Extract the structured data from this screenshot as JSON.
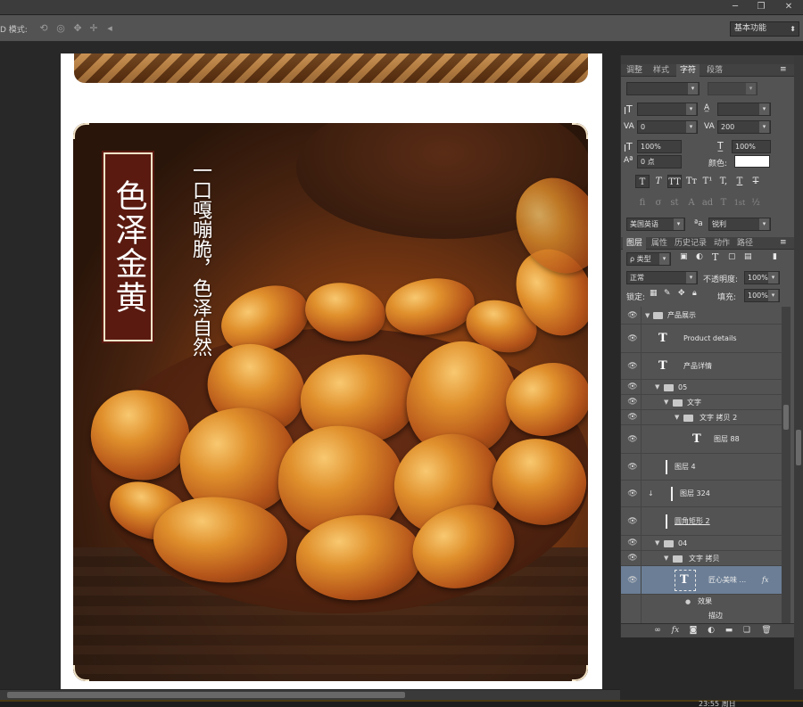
{
  "window": {
    "minimize": "─",
    "restore": "❐",
    "close": "✕"
  },
  "options_bar": {
    "mode_label": "D 模式:",
    "tools": [
      "rotate-3d-icon",
      "roll-3d-icon",
      "pan-3d-icon",
      "slide-3d-icon",
      "camera-3d-icon"
    ],
    "workspace": "基本功能"
  },
  "document": {
    "label_title": "色泽金黄",
    "tagline": "一口嘎嘣脆，色泽自然"
  },
  "char_panel": {
    "tabs": [
      "调整",
      "样式",
      "字符",
      "段落"
    ],
    "active_tab": "字符",
    "leading_value": "",
    "kerning_value": "0",
    "tracking_value": "200",
    "vscale_value": "100%",
    "hscale_value": "100%",
    "baseline_value": "0 点",
    "color_label": "颜色:",
    "color_value": "#ffffff",
    "style_buttons": [
      "T",
      "T",
      "TT",
      "Tт",
      "T¹",
      "T,",
      "T",
      "T"
    ],
    "opentype_buttons": [
      "fi",
      "σ",
      "st",
      "A",
      "ad",
      "T",
      "1st",
      "½"
    ],
    "language": "美国英语",
    "aa_label": "ªa",
    "antialias": "锐利"
  },
  "layers_panel": {
    "tabs": [
      "图层",
      "属性",
      "历史记录",
      "动作",
      "路径"
    ],
    "active_tab": "图层",
    "filter_label": "ρ 类型",
    "blend_mode": "正常",
    "opacity_label": "不透明度:",
    "opacity_value": "100%",
    "lock_label": "锁定:",
    "fill_label": "填充:",
    "fill_value": "100%",
    "layers": [
      {
        "name": "产品展示",
        "kind": "group",
        "indent": 0
      },
      {
        "name": "Product details",
        "kind": "text",
        "indent": 1
      },
      {
        "name": "产品详情",
        "kind": "text",
        "indent": 1
      },
      {
        "name": "05",
        "kind": "group",
        "indent": 1
      },
      {
        "name": "文字",
        "kind": "group",
        "indent": 2
      },
      {
        "name": "文字 拷贝 2",
        "kind": "group",
        "indent": 3
      },
      {
        "name": "图层 88",
        "kind": "text",
        "indent": 4
      },
      {
        "name": "图层 4",
        "kind": "pixel",
        "indent": 2
      },
      {
        "name": "图层 324",
        "kind": "pixel",
        "indent": 2
      },
      {
        "name": "圆角矩形 2",
        "kind": "shape",
        "indent": 2
      },
      {
        "name": "04",
        "kind": "group",
        "indent": 1
      },
      {
        "name": "文字 拷贝",
        "kind": "group",
        "indent": 2
      },
      {
        "name": "匠心美味 ...",
        "kind": "text",
        "indent": 3,
        "selected": true
      },
      {
        "name": "效果",
        "kind": "effect",
        "indent": 4
      },
      {
        "name": "描边",
        "kind": "effect-item",
        "indent": 5
      }
    ],
    "fx_label": "fx"
  },
  "status": {
    "clock": "23:55 周日"
  },
  "colors": {
    "app_bg": "#282828",
    "panel_bg": "#535353",
    "selection": "#6b7e96",
    "label_red": "#5a1a10"
  }
}
